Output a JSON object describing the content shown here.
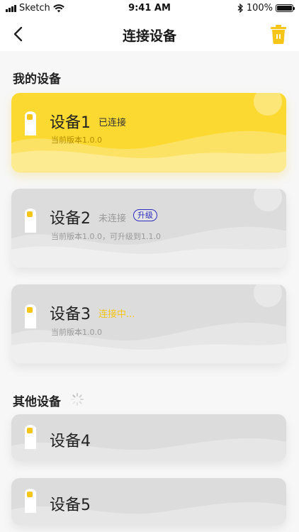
{
  "status_bar": {
    "carrier": "Sketch",
    "time": "9:41 AM",
    "battery": "100%",
    "battery_level": 1.0
  },
  "nav": {
    "title": "连接设备",
    "back_icon": "chevron-left-icon",
    "trash_icon": "trash-icon",
    "accent_color": "#fbd930"
  },
  "my_devices": {
    "title": "我的设备",
    "items": [
      {
        "name": "设备1",
        "status": "已连接",
        "version": "当前版本1.0.0",
        "state": "connected"
      },
      {
        "name": "设备2",
        "status": "未连接",
        "version": "当前版本1.0.0，可升级到1.1.0",
        "upgrade": "升级",
        "state": "disconnected"
      },
      {
        "name": "设备3",
        "status": "连接中...",
        "version": "当前版本1.0.0",
        "state": "connecting"
      }
    ]
  },
  "other_devices": {
    "title": "其他设备",
    "items": [
      {
        "name": "设备4"
      },
      {
        "name": "设备5"
      }
    ]
  },
  "colors": {
    "connected_bg": "#fbd930",
    "card_grey": "#dcdcdc",
    "connecting_text": "#f5c518",
    "upgrade_blue": "#2b2bbf"
  }
}
